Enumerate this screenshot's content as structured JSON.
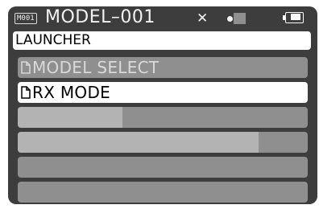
{
  "status": {
    "model_id": "M001",
    "model_name": "MODEL–001",
    "no_signal_symbol": "✕"
  },
  "header": {
    "title": "LAUNCHER"
  },
  "menu": [
    {
      "label": "MODEL SELECT",
      "icon": "document-icon",
      "selected": false
    },
    {
      "label": "RX MODE",
      "icon": "document-icon",
      "selected": true
    },
    {
      "label": "",
      "fill_fraction": 0.36
    },
    {
      "label": "",
      "fill_fraction": 0.83
    },
    {
      "label": ""
    },
    {
      "label": ""
    }
  ],
  "colors": {
    "frame": "#3d3d3d",
    "row": "#8f8f8f",
    "row_selected": "#ffffff",
    "text_light": "#f2f2f2"
  }
}
